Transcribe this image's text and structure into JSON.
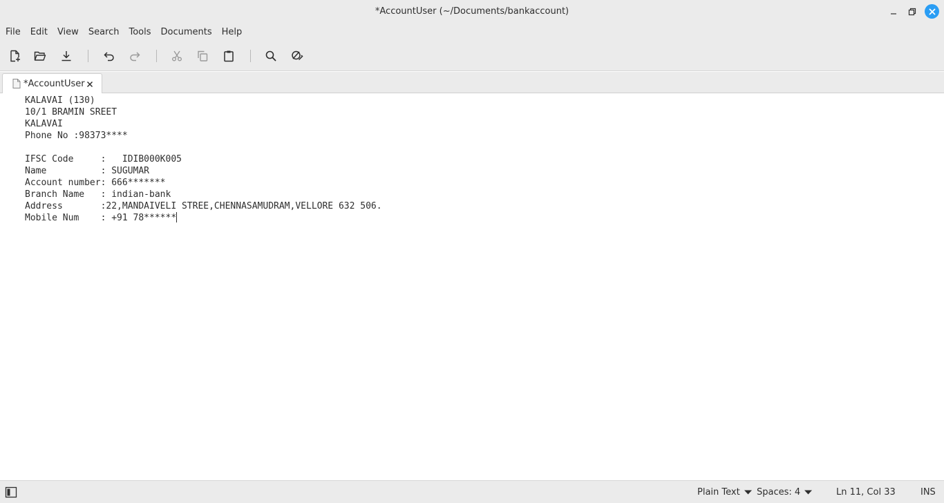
{
  "window": {
    "title": "*AccountUser (~/Documents/bankaccount)"
  },
  "menu": {
    "items": [
      "File",
      "Edit",
      "View",
      "Search",
      "Tools",
      "Documents",
      "Help"
    ]
  },
  "toolbar": {
    "buttons": [
      "new-document-icon",
      "open-folder-icon",
      "save-download-icon",
      "undo-icon",
      "redo-icon",
      "cut-icon",
      "copy-icon",
      "paste-icon",
      "search-icon",
      "spellcheck-icon"
    ]
  },
  "tab": {
    "label": "*AccountUser"
  },
  "editor": {
    "lines": [
      "KALAVAI (130)",
      "10/1 BRAMIN SREET",
      "KALAVAI",
      "Phone No :98373****",
      "",
      "IFSC Code     :   IDIB000K005",
      "Name          : SUGUMAR",
      "Account number: 666*******",
      "Branch Name   : indian-bank",
      "Address       :22,MANDAIVELI STREE,CHENNASAMUDRAM,VELLORE 632 506.",
      "Mobile Num    : +91 78******"
    ]
  },
  "status": {
    "language": "Plain Text",
    "spaces": "Spaces: 4",
    "position": "Ln 11, Col 33",
    "mode": "INS"
  },
  "colors": {
    "chrome": "#ebebeb",
    "accent": "#2a9df4",
    "text": "#2e2e2e"
  }
}
